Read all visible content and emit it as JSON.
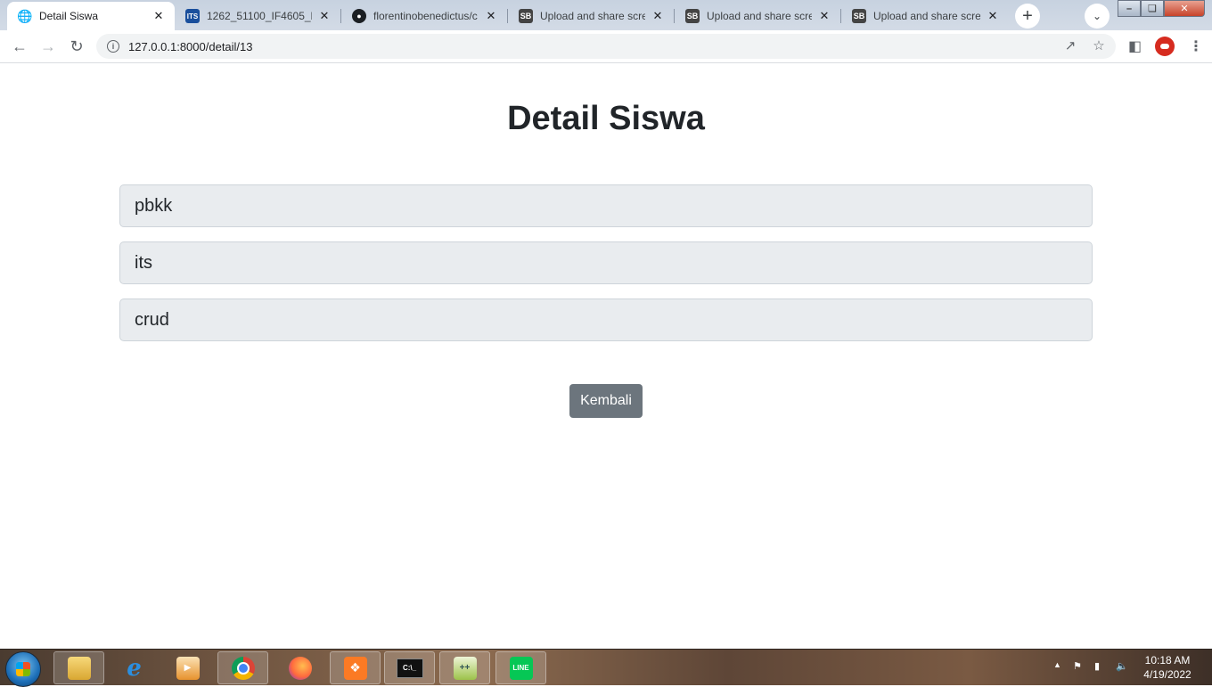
{
  "browser": {
    "tabs": [
      {
        "title": "Detail Siswa",
        "icon": "globe-icon",
        "active": true
      },
      {
        "title": "1262_51100_IF4605_Pe",
        "icon": "its-icon",
        "active": false
      },
      {
        "title": "florentinobenedictus/c",
        "icon": "github-icon",
        "active": false
      },
      {
        "title": "Upload and share scree",
        "icon": "sb-icon",
        "active": false
      },
      {
        "title": "Upload and share scree",
        "icon": "sb-icon",
        "active": false
      },
      {
        "title": "Upload and share scree",
        "icon": "sb-icon",
        "active": false
      }
    ],
    "url": "127.0.0.1:8000/detail/13"
  },
  "page": {
    "title": "Detail Siswa",
    "fields": [
      "pbkk",
      "its",
      "crud"
    ],
    "back_button": "Kembali"
  },
  "taskbar": {
    "apps": [
      {
        "name": "file-explorer-icon"
      },
      {
        "name": "internet-explorer-icon"
      },
      {
        "name": "media-player-icon"
      },
      {
        "name": "chrome-icon"
      },
      {
        "name": "firefox-icon"
      },
      {
        "name": "xampp-icon"
      },
      {
        "name": "command-prompt-icon"
      },
      {
        "name": "notepad-plus-plus-icon"
      },
      {
        "name": "line-icon"
      }
    ],
    "time": "10:18 AM",
    "date": "4/19/2022"
  },
  "colors": {
    "button": "#6c757d",
    "field_bg": "#e9ecef",
    "title": "#212529"
  }
}
